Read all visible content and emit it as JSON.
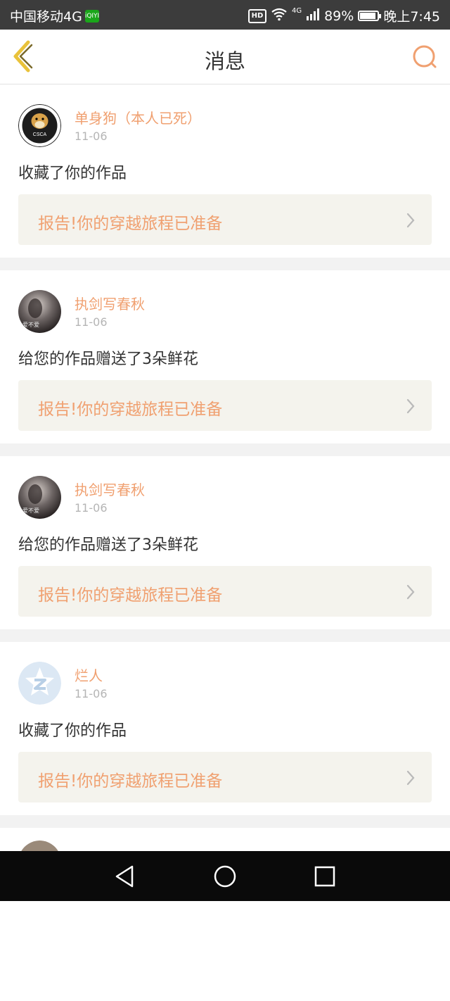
{
  "status_bar": {
    "carrier": "中国移动4G",
    "carrier_app_badge": "iQIYI",
    "hd_badge": "HD",
    "network": "4G",
    "battery_percent": "89%",
    "battery_level": 0.89,
    "time": "晚上7:45"
  },
  "header": {
    "title": "消息",
    "back_icon": "chevron-left-icon",
    "search_icon": "search-icon",
    "accent_color": "#f0a070"
  },
  "messages": [
    {
      "username": "单身狗（本人已死）",
      "date": "11-06",
      "action": "收藏了你的作品",
      "link_text": "报告!你的穿越旅程已准备",
      "avatar_label": "CSCA"
    },
    {
      "username": "执剑写春秋",
      "date": "11-06",
      "action": "给您的作品赠送了3朵鲜花",
      "link_text": "报告!你的穿越旅程已准备",
      "avatar_label": "爱不爱"
    },
    {
      "username": "执剑写春秋",
      "date": "11-06",
      "action": "给您的作品赠送了3朵鲜花",
      "link_text": "报告!你的穿越旅程已准备",
      "avatar_label": "爱不爱"
    },
    {
      "username": "烂人",
      "date": "11-06",
      "action": "收藏了你的作品",
      "link_text": "报告!你的穿越旅程已准备",
      "avatar_label": ""
    }
  ],
  "nav_bar": {
    "back_icon": "triangle-back-icon",
    "home_icon": "circle-home-icon",
    "recents_icon": "square-recents-icon"
  }
}
